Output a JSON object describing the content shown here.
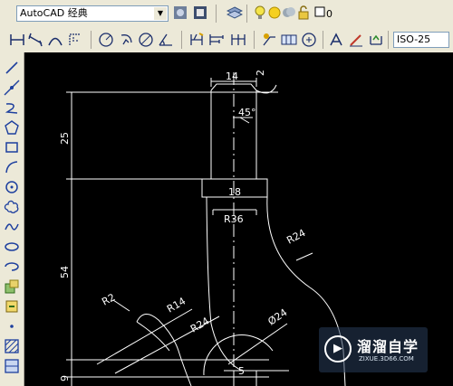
{
  "workspace": {
    "value": "AutoCAD 经典"
  },
  "layer": {
    "value": "0"
  },
  "dimstyle": {
    "value": "ISO-25"
  },
  "row1_icons": [
    "workspace-settings-icon",
    "workspace-toolbar-icon",
    "layers-icon",
    "lightbulb-icon",
    "sun-icon",
    "freeze-icon",
    "lock-icon",
    "color-swatch-icon"
  ],
  "row2_icons": [
    "linear-dim-icon",
    "aligned-dim-icon",
    "arc-length-icon",
    "ordinate-dim-icon",
    "radius-dim-icon",
    "jogged-dim-icon",
    "diameter-dim-icon",
    "angular-dim-icon",
    "quick-dim-icon",
    "baseline-dim-icon",
    "continue-dim-icon",
    "quick-leader-icon",
    "tolerance-icon",
    "center-mark-icon",
    "dim-edit-icon",
    "dim-text-edit-icon",
    "dim-update-icon"
  ],
  "left_icons": [
    "line-icon",
    "construction-line-icon",
    "polyline-icon",
    "polygon-icon",
    "rectangle-icon",
    "arc-icon",
    "circle-icon",
    "revision-cloud-icon",
    "spline-icon",
    "ellipse-icon",
    "ellipse-arc-icon",
    "insert-block-icon",
    "make-block-icon",
    "point-icon",
    "hatch-icon",
    "gradient-icon"
  ],
  "drawing": {
    "dims": {
      "d14": "14",
      "d2": "2",
      "d45": "45°",
      "d25": "25",
      "d18": "18",
      "r36": "R36",
      "r24_right": "R24",
      "d54": "54",
      "r2": "R2",
      "r14": "R14",
      "r24_left": "R24",
      "phi24": "Ø24",
      "d9": "9",
      "d5": "5"
    }
  },
  "watermark": {
    "title": "溜溜自学",
    "url": "ZIXUE.3D66.COM"
  }
}
